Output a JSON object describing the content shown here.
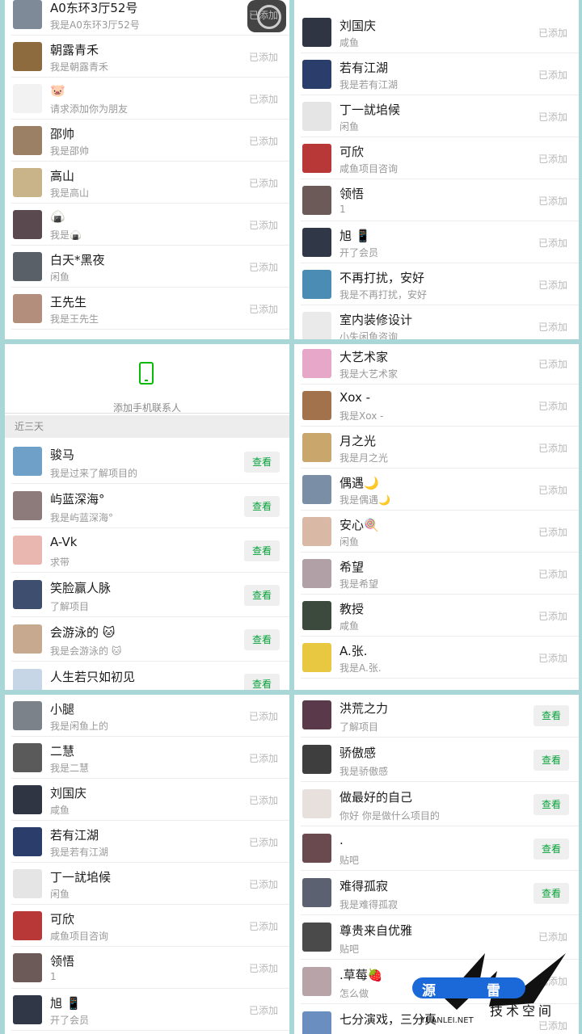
{
  "labels": {
    "added": "已添加",
    "view": "查看",
    "add_phone_contacts": "添加手机联系人",
    "recent_three_days": "近三天"
  },
  "panel1": [
    {
      "name": "A0东环3厅52号",
      "sub": "我是A0东环3厅52号",
      "color": "#7f8a99"
    },
    {
      "name": "朝露青禾",
      "sub": "我是朝露青禾",
      "color": "#8e6b3e"
    },
    {
      "name": "🐷",
      "sub": "请求添加你为朋友",
      "color": "#f2f2f2"
    },
    {
      "name": "邵帅",
      "sub": "我是邵帅",
      "color": "#9b8066"
    },
    {
      "name": "高山",
      "sub": "我是高山",
      "color": "#c9b48a"
    },
    {
      "name": "🍙",
      "sub": "我是🍙",
      "color": "#5a4a4f"
    },
    {
      "name": "白天*黑夜",
      "sub": "闲鱼",
      "color": "#596068"
    },
    {
      "name": "王先生",
      "sub": "我是王先生",
      "color": "#b38e7c"
    }
  ],
  "panel2": [
    {
      "name": "刘国庆",
      "sub": "咸鱼",
      "color": "#2f3542"
    },
    {
      "name": "若有江湖",
      "sub": "我是若有江湖",
      "color": "#2a3d6b"
    },
    {
      "name": "丁一訧垖候",
      "sub": "闲鱼",
      "color": "#e5e5e5"
    },
    {
      "name": "可欣",
      "sub": "咸鱼项目咨询",
      "color": "#b83838"
    },
    {
      "name": "领悟",
      "sub": "1",
      "color": "#6b5a58"
    },
    {
      "name": "旭 📱",
      "sub": "开了会员",
      "color": "#303848"
    },
    {
      "name": "不再打扰，安好",
      "sub": "我是不再打扰，安好",
      "color": "#4a8cb3"
    },
    {
      "name": "室内装修设计",
      "sub": "小失闲鱼咨询",
      "color": "#eaeaea"
    }
  ],
  "panel3": [
    {
      "name": "骏马",
      "sub": "我是过来了解项目的",
      "color": "#6fa0c8"
    },
    {
      "name": "屿蓝深海°",
      "sub": "我是屿蓝深海°",
      "color": "#8d7b7b"
    },
    {
      "name": "A-Vk",
      "sub": "求带",
      "color": "#e9b7b0"
    },
    {
      "name": "笑脸赢人脉",
      "sub": "了解项目",
      "color": "#3d4e6e"
    },
    {
      "name": "会游泳的 🐱",
      "sub": "我是会游泳的 🐱",
      "color": "#c7a98f"
    },
    {
      "name": "人生若只如初见",
      "sub": "",
      "color": "#c7d6e6"
    }
  ],
  "panel4": [
    {
      "name": "大艺术家",
      "sub": "我是大艺术家",
      "color": "#e7a7c9"
    },
    {
      "name": "Xox -",
      "sub": "我是Xox -",
      "color": "#a2724d"
    },
    {
      "name": "月之光",
      "sub": "我是月之光",
      "color": "#c9a66b"
    },
    {
      "name": "偶遇🌙",
      "sub": "我是偶遇🌙",
      "color": "#7a8ea6"
    },
    {
      "name": "安心🍭",
      "sub": "闲鱼",
      "color": "#d9b9a5"
    },
    {
      "name": "希望",
      "sub": "我是希望",
      "color": "#b1a1a6"
    },
    {
      "name": "教授",
      "sub": "咸鱼",
      "color": "#3c4a3e"
    },
    {
      "name": "A.张.",
      "sub": "我是A.张.",
      "color": "#e8c840"
    }
  ],
  "panel5": [
    {
      "name": "小腿",
      "sub": "我是闲鱼上的",
      "color": "#7c8289"
    },
    {
      "name": "二慧",
      "sub": "我是二慧",
      "color": "#5a5a5a"
    },
    {
      "name": "刘国庆",
      "sub": "咸鱼",
      "color": "#2f3542"
    },
    {
      "name": "若有江湖",
      "sub": "我是若有江湖",
      "color": "#2a3d6b"
    },
    {
      "name": "丁一訧垖候",
      "sub": "闲鱼",
      "color": "#e5e5e5"
    },
    {
      "name": "可欣",
      "sub": "咸鱼项目咨询",
      "color": "#b83838"
    },
    {
      "name": "领悟",
      "sub": "1",
      "color": "#6b5a58"
    },
    {
      "name": "旭 📱",
      "sub": "开了会员",
      "color": "#303848"
    }
  ],
  "panel6": [
    {
      "name": "洪荒之力",
      "sub": "了解项目",
      "color": "#5a3a4a"
    },
    {
      "name": "骄傲感",
      "sub": "我是骄傲感",
      "color": "#3e3e3e"
    },
    {
      "name": "做最好的自己",
      "sub": "你好 你是做什么项目的",
      "color": "#e8e0dc"
    },
    {
      "name": ".",
      "sub": "贴吧",
      "color": "#6b4a4f"
    },
    {
      "name": "难得孤寂",
      "sub": "我是难得孤寂",
      "color": "#5b6170"
    },
    {
      "name": "尊贵来自优雅",
      "sub": "贴吧",
      "color": "#4a4a4a"
    },
    {
      "name": ".草莓🍓",
      "sub": "怎么做",
      "color": "#b8a4a8"
    },
    {
      "name": "七分演戏，三分真",
      "sub": "",
      "color": "#6a8ec0"
    }
  ],
  "watermark": {
    "c1": "源",
    "c2": "雷",
    "subtitle": "技术空间",
    "url": "YUANLEI.NET"
  }
}
